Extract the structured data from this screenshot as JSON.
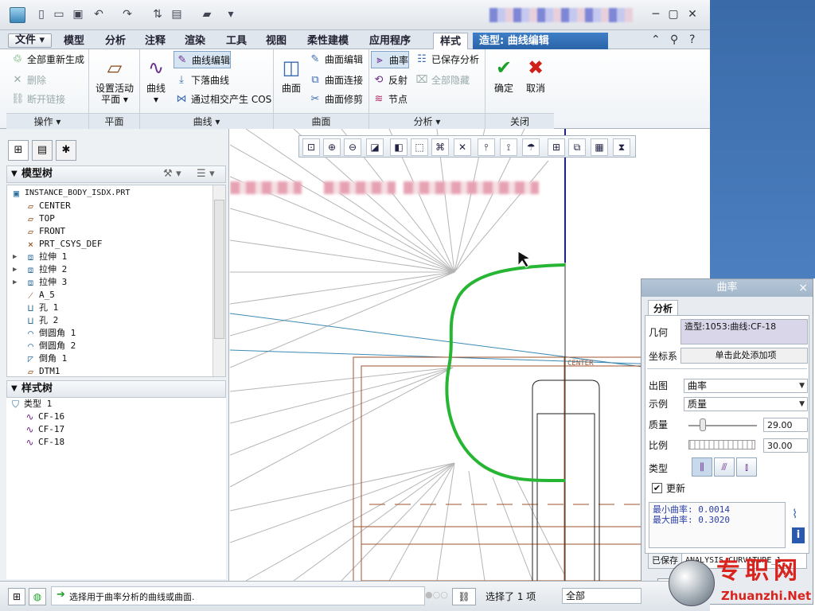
{
  "quick_toolbar": {
    "icons": [
      "new-icon",
      "open-icon",
      "save-icon",
      "undo-icon",
      "redo-icon",
      "regenerate-icon",
      "windows-icon",
      "folder-icon",
      "customize-icon"
    ]
  },
  "ribbon_tabs": {
    "file": "文件",
    "items": [
      "模型",
      "分析",
      "注释",
      "渲染",
      "工具",
      "视图",
      "柔性建模",
      "应用程序"
    ],
    "active": "样式",
    "context": "造型: 曲线编辑"
  },
  "ribbon": {
    "operations": {
      "regen_all": "全部重新生成",
      "delete": "删除",
      "break_link": "断开链接",
      "label": "操作"
    },
    "plane": {
      "set_active": "设置活动",
      "plane": "平面",
      "label": "平面"
    },
    "curve": {
      "curve": "曲线",
      "curve_edit": "曲线编辑",
      "drop_curve": "下落曲线",
      "cos": "通过相交产生 COS",
      "label": "曲线"
    },
    "surface": {
      "surface": "曲面",
      "surface_edit": "曲面编辑",
      "surface_connect": "曲面连接",
      "surface_trim": "曲面修剪",
      "label": "曲面"
    },
    "analysis": {
      "curvature": "曲率",
      "saved_analysis": "已保存分析",
      "reflection": "反射",
      "hide_all": "全部隐藏",
      "node": "节点",
      "label": "分析"
    },
    "close": {
      "ok": "确定",
      "cancel": "取消",
      "label": "关闭"
    }
  },
  "model_tree": {
    "title": "模型树",
    "root": "INSTANCE_BODY_ISDX.PRT",
    "items": [
      {
        "label": "CENTER",
        "icon": "plane-icon"
      },
      {
        "label": "TOP",
        "icon": "plane-icon"
      },
      {
        "label": "FRONT",
        "icon": "plane-icon"
      },
      {
        "label": "PRT_CSYS_DEF",
        "icon": "csys-icon"
      },
      {
        "label": "拉伸 1",
        "icon": "extrude-icon"
      },
      {
        "label": "拉伸 2",
        "icon": "extrude-icon"
      },
      {
        "label": "拉伸 3",
        "icon": "extrude-icon"
      },
      {
        "label": "A_5",
        "icon": "axis-icon"
      },
      {
        "label": "孔 1",
        "icon": "hole-icon"
      },
      {
        "label": "孔 2",
        "icon": "hole-icon"
      },
      {
        "label": "倒圆角 1",
        "icon": "round-icon"
      },
      {
        "label": "倒圆角 2",
        "icon": "round-icon"
      },
      {
        "label": "倒角 1",
        "icon": "chamfer-icon"
      },
      {
        "label": "DTM1",
        "icon": "plane-icon"
      }
    ]
  },
  "style_tree": {
    "title": "样式树",
    "type": "类型 1",
    "items": [
      "CF-16",
      "CF-17",
      "CF-18"
    ]
  },
  "viewport": {
    "label_center": "CENTER"
  },
  "curvature_dialog": {
    "title": "曲率",
    "tab": "分析",
    "geometry_label": "几何",
    "geometry_value": "造型:1053:曲线:CF-18",
    "csys_label": "坐标系",
    "csys_value": "单击此处添加项",
    "plot_label": "出图",
    "plot_value": "曲率",
    "example_label": "示例",
    "example_value": "质量",
    "quality_label": "质量",
    "quality_value": "29.00",
    "scale_label": "比例",
    "scale_value": "30.00",
    "type_label": "类型",
    "update_label": "更新",
    "update_checked": true,
    "min_curvature": "最小曲率:  0.0014",
    "max_curvature": "最大曲率:  0.3020",
    "saved_label": "已保存",
    "saved_value": "ANALYSIS_CURVATURE_1"
  },
  "status_bar": {
    "message": "选择用于曲率分析的曲线或曲面.",
    "selected": "选择了 1 项",
    "filter": "全部"
  },
  "watermark": {
    "text": "专职网",
    "url": "Zhuanzhi.Net"
  },
  "colors": {
    "curve": "#27b534",
    "accent": "#2a63a8",
    "datum": "#a0522d"
  }
}
